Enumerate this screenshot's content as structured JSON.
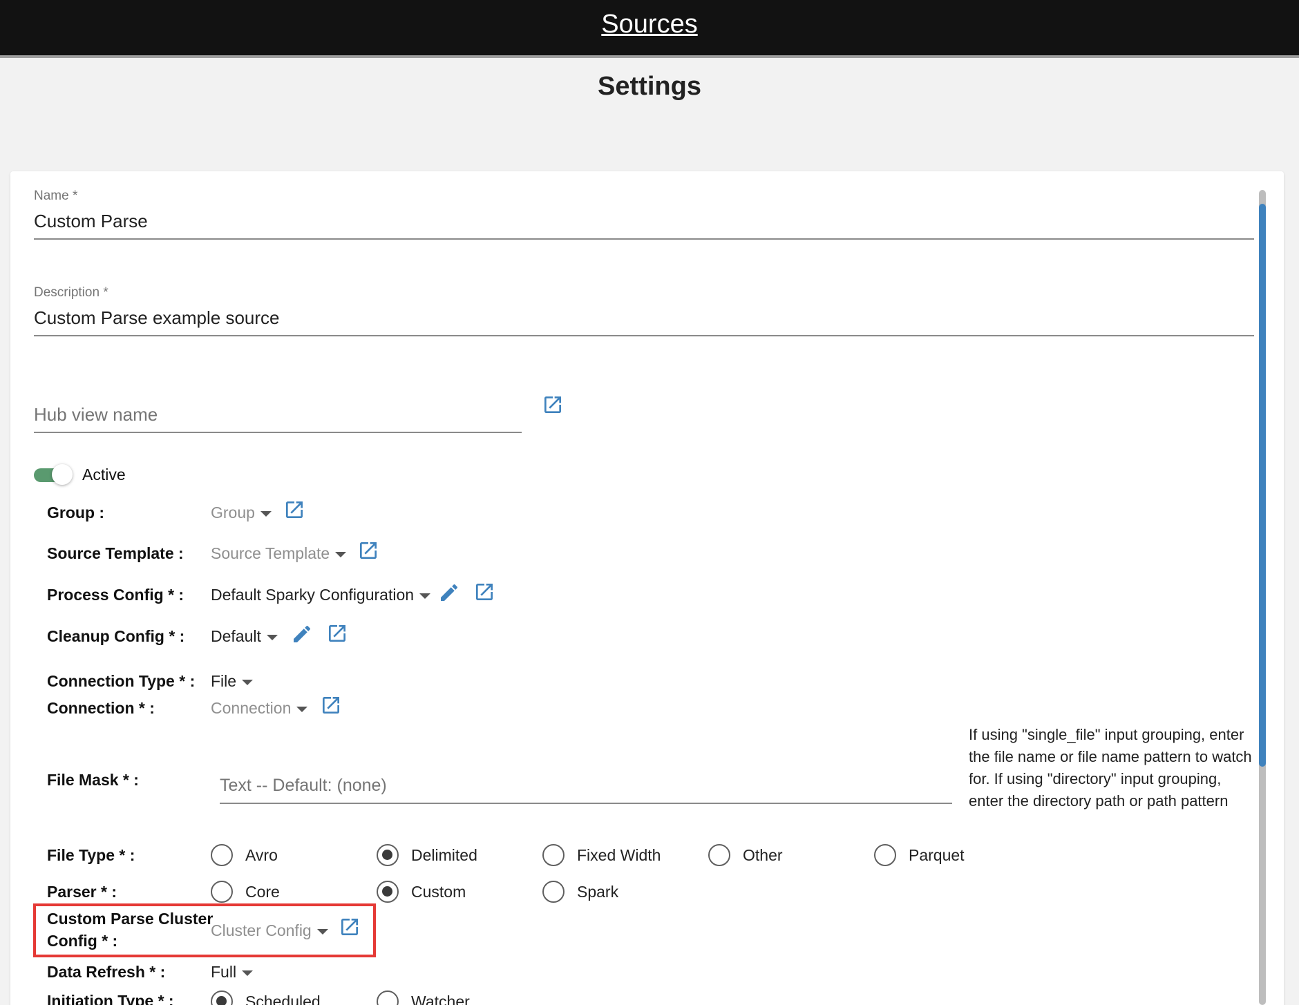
{
  "header": {
    "title": "Sources"
  },
  "page": {
    "title": "Settings"
  },
  "form": {
    "name": {
      "label": "Name *",
      "value": "Custom Parse"
    },
    "description": {
      "label": "Description *",
      "value": "Custom Parse example source"
    },
    "hub_view": {
      "placeholder": "Hub view name"
    },
    "active": {
      "label": "Active",
      "on": true
    },
    "group": {
      "label": "Group :",
      "value": "Group"
    },
    "source_template": {
      "label": "Source Template :",
      "value": "Source Template"
    },
    "process_config": {
      "label": "Process Config * :",
      "value": "Default Sparky Configuration"
    },
    "cleanup_config": {
      "label": "Cleanup Config * :",
      "value": "Default"
    },
    "connection_type": {
      "label": "Connection Type * :",
      "value": "File"
    },
    "connection": {
      "label": "Connection * :",
      "value": "Connection"
    },
    "file_mask": {
      "label": "File Mask * :",
      "placeholder": "Text -- Default: (none)",
      "help": "If using \"single_file\" input grouping, enter the file name or file name pattern to watch for. If using \"directory\" input grouping, enter the directory path or path pattern"
    },
    "file_type": {
      "label": "File Type * :",
      "options": [
        "Avro",
        "Delimited",
        "Fixed Width",
        "Other",
        "Parquet"
      ],
      "selected": "Delimited"
    },
    "parser": {
      "label": "Parser * :",
      "options": [
        "Core",
        "Custom",
        "Spark"
      ],
      "selected": "Custom"
    },
    "custom_parse_cluster_config": {
      "label_line1": "Custom Parse Cluster",
      "label_line2": "Config * :",
      "value": "Cluster Config"
    },
    "data_refresh": {
      "label": "Data Refresh * :",
      "value": "Full"
    },
    "initiation_type": {
      "label": "Initiation Type * :",
      "options": [
        "Scheduled",
        "Watcher"
      ],
      "selected": "Scheduled"
    }
  },
  "colors": {
    "accent": "#3f82bd",
    "toggle_on": "#5a9a6f",
    "highlight": "#e53935",
    "topbar": "#121212"
  }
}
